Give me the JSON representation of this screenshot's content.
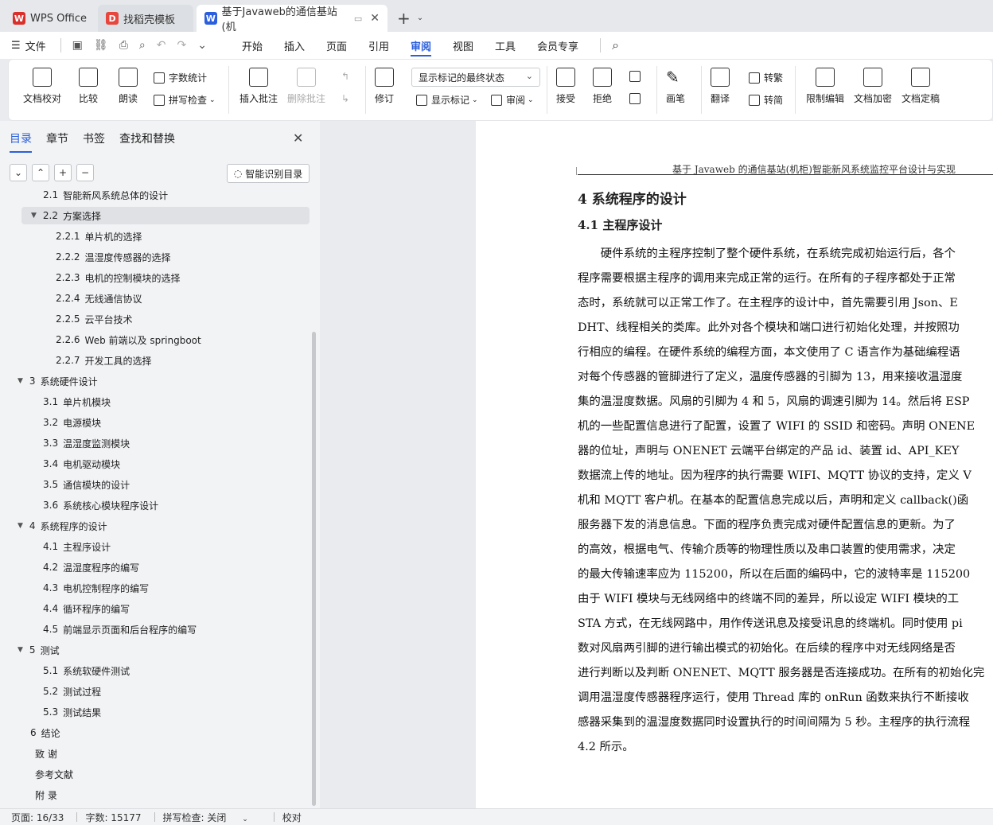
{
  "tabs": [
    {
      "label": "WPS Office",
      "icon": "wps-logo-icon"
    },
    {
      "label": "找稻壳模板",
      "icon": "docer-icon"
    },
    {
      "label": "基于Javaweb的通信基站(机",
      "icon": "writer-icon"
    }
  ],
  "menu": {
    "file": "文件",
    "items": [
      "开始",
      "插入",
      "页面",
      "引用",
      "审阅",
      "视图",
      "工具",
      "会员专享"
    ],
    "active": "审阅"
  },
  "ribbon": {
    "doc_check": "文档校对",
    "compare": "比较",
    "read_aloud": "朗读",
    "word_count": "字数统计",
    "spell_check": "拼写检查",
    "insert_comment": "插入批注",
    "delete_comment": "删除批注",
    "revise": "修订",
    "markup_state": "显示标记的最终状态",
    "show_markup": "显示标记",
    "review": "审阅",
    "accept": "接受",
    "reject": "拒绝",
    "pen": "画笔",
    "translate": "翻译",
    "to_traditional": "转繁",
    "to_simplified": "转简",
    "restrict_edit": "限制编辑",
    "encrypt": "文档加密",
    "finalize": "文档定稿"
  },
  "panel": {
    "tabs": [
      "目录",
      "章节",
      "书签",
      "查找和替换"
    ],
    "active_tab": "目录",
    "smart_toc": "智能识别目录",
    "toc": [
      {
        "num": "2.1",
        "text": "智能新风系统总体的设计",
        "level": 1
      },
      {
        "num": "2.2",
        "text": "方案选择",
        "level": 1
      },
      {
        "num": "2.2.1",
        "text": "单片机的选择",
        "level": 2
      },
      {
        "num": "2.2.2",
        "text": "温湿度传感器的选择",
        "level": 2
      },
      {
        "num": "2.2.3",
        "text": "电机的控制模块的选择",
        "level": 2
      },
      {
        "num": "2.2.4",
        "text": "无线通信协议",
        "level": 2
      },
      {
        "num": "2.2.5",
        "text": "云平台技术",
        "level": 2
      },
      {
        "num": "2.2.6",
        "text": "Web 前端以及 springboot",
        "level": 2
      },
      {
        "num": "2.2.7",
        "text": "开发工具的选择",
        "level": 2
      },
      {
        "num": "3",
        "text": "系统硬件设计",
        "level": 0
      },
      {
        "num": "3.1",
        "text": "单片机模块",
        "level": 1
      },
      {
        "num": "3.2",
        "text": "电源模块",
        "level": 1
      },
      {
        "num": "3.3",
        "text": "温湿度监测模块",
        "level": 1
      },
      {
        "num": "3.4",
        "text": "电机驱动模块",
        "level": 1
      },
      {
        "num": "3.5",
        "text": "通信模块的设计",
        "level": 1
      },
      {
        "num": "3.6",
        "text": "系统核心模块程序设计",
        "level": 1
      },
      {
        "num": "4",
        "text": "系统程序的设计",
        "level": 0
      },
      {
        "num": "4.1",
        "text": "主程序设计",
        "level": 1
      },
      {
        "num": "4.2",
        "text": "温湿度程序的编写",
        "level": 1
      },
      {
        "num": "4.3",
        "text": "电机控制程序的编写",
        "level": 1
      },
      {
        "num": "4.4",
        "text": "循环程序的编写",
        "level": 1
      },
      {
        "num": "4.5",
        "text": "前端显示页面和后台程序的编写",
        "level": 1
      },
      {
        "num": "5",
        "text": "测试",
        "level": 0
      },
      {
        "num": "5.1",
        "text": "系统软硬件测试",
        "level": 1
      },
      {
        "num": "5.2",
        "text": "测试过程",
        "level": 1
      },
      {
        "num": "5.3",
        "text": "测试结果",
        "level": 1
      },
      {
        "num": "6",
        "text": "结论",
        "level": 0
      },
      {
        "num": "",
        "text": "致 谢",
        "level": 0
      },
      {
        "num": "",
        "text": "参考文献",
        "level": 0
      },
      {
        "num": "",
        "text": "附 录",
        "level": 0
      }
    ]
  },
  "document": {
    "header": "基于 Javaweb 的通信基站(机柜)智能新风系统监控平台设计与实现",
    "h1": "4  系统程序的设计",
    "h2": "4.1  主程序设计",
    "lines": [
      "　　硬件系统的主程序控制了整个硬件系统，在系统完成初始运行后，各个",
      "程序需要根据主程序的调用来完成正常的运行。在所有的子程序都处于正常",
      "态时，系统就可以正常工作了。在主程序的设计中，首先需要引用 Json、E",
      "DHT、线程相关的类库。此外对各个模块和端口进行初始化处理，并按照功",
      "行相应的编程。在硬件系统的编程方面，本文使用了 C 语言作为基础编程语",
      "对每个传感器的管脚进行了定义，温度传感器的引脚为 13，用来接收温湿度",
      "集的温湿度数据。风扇的引脚为 4 和 5，风扇的调速引脚为 14。然后将 ESP",
      "机的一些配置信息进行了配置，设置了 WIFI 的 SSID 和密码。声明 ONENE",
      "器的位址，声明与 ONENET 云端平台绑定的产品 id、装置 id、API_KEY",
      "数据流上传的地址。因为程序的执行需要 WIFI、MQTT 协议的支持，定义 V",
      "机和 MQTT 客户机。在基本的配置信息完成以后，声明和定义 callback()函",
      "服务器下发的消息信息。下面的程序负责完成对硬件配置信息的更新。为了",
      "的高效，根据电气、传输介质等的物理性质以及串口装置的使用需求，决定",
      "的最大传输速率应为 115200，所以在后面的编码中，它的波特率是 115200",
      "由于 WIFI 模块与无线网络中的终端不同的差异，所以设定 WIFI 模块的工",
      "STA 方式，在无线网路中，用作传送讯息及接受讯息的终端机。同时使用 pi",
      "数对风扇两引脚的进行输出模式的初始化。在后续的程序中对无线网络是否",
      "进行判断以及判断 ONENET、MQTT 服务器是否连接成功。在所有的初始化完",
      "调用温湿度传感器程序运行，使用 Thread 库的 onRun 函数来执行不断接收",
      "感器采集到的温湿度数据同时设置执行的时间间隔为 5 秒。主程序的执行流程",
      "4.2 所示。"
    ]
  },
  "status": {
    "page": "页面: 16/33",
    "words": "字数: 15177",
    "spell": "拼写检查: 关闭",
    "proof": "校对"
  },
  "colors": {
    "accent": "#2b5fdd",
    "wps_red": "#d9302c"
  }
}
